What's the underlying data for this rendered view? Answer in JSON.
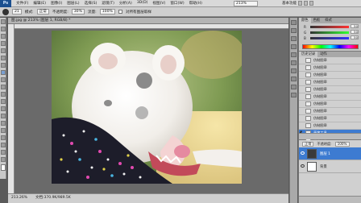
{
  "app": {
    "logo": "Ps"
  },
  "menu": [
    "文件(F)",
    "编辑(E)",
    "图像(I)",
    "图层(L)",
    "选择(S)",
    "滤镜(T)",
    "分析(A)",
    "3D(D)",
    "视图(V)",
    "窗口(W)",
    "帮助(H)"
  ],
  "zoom": "213%",
  "workspace": "基本功能",
  "options": {
    "brush_size": "21",
    "mode_label": "模式:",
    "mode_value": "正常",
    "opacity_label": "不透明度:",
    "opacity_value": "30%",
    "flow_label": "流量:",
    "flow_value": "100%",
    "sample_label": "对所有图层取样"
  },
  "document": {
    "tab_title": "图.jpg @ 213% (图层 1, RGB/8) *",
    "zoom_status": "213.26%",
    "doc_status": "文档:370.9K/989.5K"
  },
  "color_panel": {
    "tabs": [
      "颜色",
      "色板",
      "样式"
    ],
    "channels": [
      {
        "label": "R",
        "value": "50"
      },
      {
        "label": "G",
        "value": "50"
      },
      {
        "label": "B",
        "value": "50"
      }
    ]
  },
  "history_panel": {
    "tabs": [
      "历史记录",
      "动作"
    ],
    "items": [
      {
        "label": "仿制图章",
        "state": "normal"
      },
      {
        "label": "仿制图章",
        "state": "normal"
      },
      {
        "label": "仿制图章",
        "state": "normal"
      },
      {
        "label": "仿制图章",
        "state": "normal"
      },
      {
        "label": "仿制图章",
        "state": "normal"
      },
      {
        "label": "仿制图章",
        "state": "normal"
      },
      {
        "label": "仿制图章",
        "state": "normal"
      },
      {
        "label": "仿制图章",
        "state": "normal"
      },
      {
        "label": "仿制图章",
        "state": "normal"
      },
      {
        "label": "仿制图章",
        "state": "normal"
      },
      {
        "label": "画笔工具",
        "state": "selected"
      },
      {
        "label": "画笔工具",
        "state": "dim"
      }
    ]
  },
  "layers_panel": {
    "blend_mode": "正常",
    "opacity_label": "不透明度:",
    "opacity_value": "100%",
    "layers": [
      {
        "name": "图层 1",
        "active": true
      },
      {
        "name": "背景",
        "active": false
      }
    ]
  }
}
